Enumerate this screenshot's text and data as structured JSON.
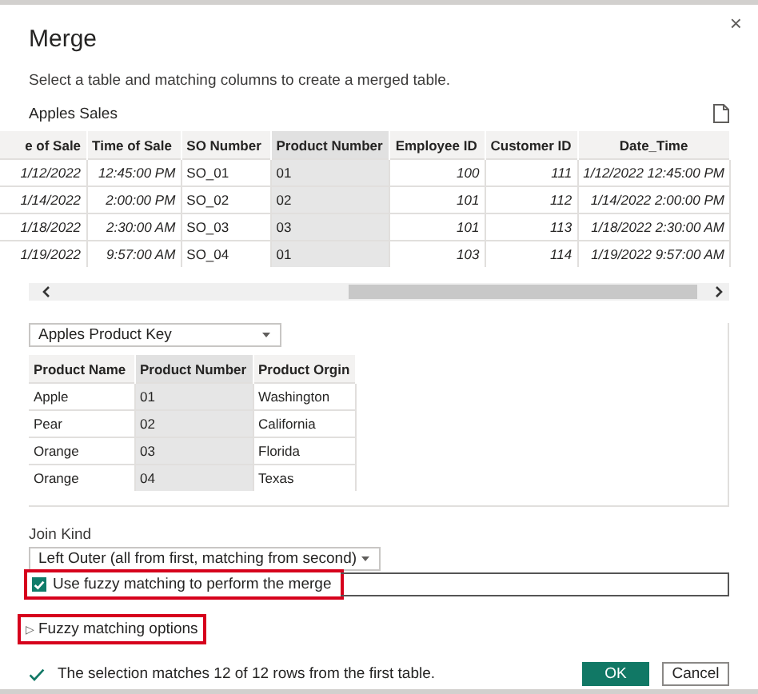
{
  "dialog": {
    "title": "Merge",
    "close": "×",
    "description": "Select a table and matching columns to create a merged table."
  },
  "first_table": {
    "name": "Apples Sales",
    "columns": [
      {
        "label": "e of Sale",
        "kind": "number",
        "selected": false
      },
      {
        "label": "Time of Sale",
        "kind": "number",
        "selected": false
      },
      {
        "label": "SO Number",
        "kind": "text",
        "selected": false
      },
      {
        "label": "Product Number",
        "kind": "text",
        "selected": true
      },
      {
        "label": "Employee ID",
        "kind": "number",
        "selected": false
      },
      {
        "label": "Customer ID",
        "kind": "number",
        "selected": false
      },
      {
        "label": "Date_Time",
        "kind": "number",
        "selected": false
      }
    ],
    "rows": [
      [
        "1/12/2022",
        "12:45:00 PM",
        "SO_01",
        "01",
        "100",
        "111",
        "1/12/2022 12:45:00 PM"
      ],
      [
        "1/14/2022",
        "2:00:00 PM",
        "SO_02",
        "02",
        "101",
        "112",
        "1/14/2022 2:00:00 PM"
      ],
      [
        "1/18/2022",
        "2:30:00 AM",
        "SO_03",
        "03",
        "101",
        "113",
        "1/18/2022 2:30:00 AM"
      ],
      [
        "1/19/2022",
        "9:57:00 AM",
        "SO_04",
        "01",
        "103",
        "114",
        "1/19/2022 9:57:00 AM"
      ]
    ]
  },
  "second_table": {
    "selector": "Apples Product Key",
    "columns": [
      {
        "label": "Product Name",
        "selected": false
      },
      {
        "label": "Product Number",
        "selected": true
      },
      {
        "label": "Product Orgin",
        "selected": false
      }
    ],
    "rows": [
      [
        "Apple",
        "01",
        "Washington"
      ],
      [
        "Pear",
        "02",
        "California"
      ],
      [
        "Orange",
        "03",
        "Florida"
      ],
      [
        "Orange",
        "04",
        "Texas"
      ]
    ]
  },
  "join_kind": {
    "label": "Join Kind",
    "value": "Left Outer (all from first, matching from second)"
  },
  "fuzzy": {
    "label": "Use fuzzy matching to perform the merge",
    "checked": true,
    "highlighted": true
  },
  "fuzzy_options": {
    "arrow": "▷",
    "label": "Fuzzy matching options",
    "expanded": false,
    "highlighted": true
  },
  "status": "The selection matches 12 of 12 rows from the first table.",
  "buttons": [
    {
      "label": "OK",
      "kind": "primary"
    },
    {
      "label": "Cancel",
      "kind": "secondary"
    }
  ]
}
